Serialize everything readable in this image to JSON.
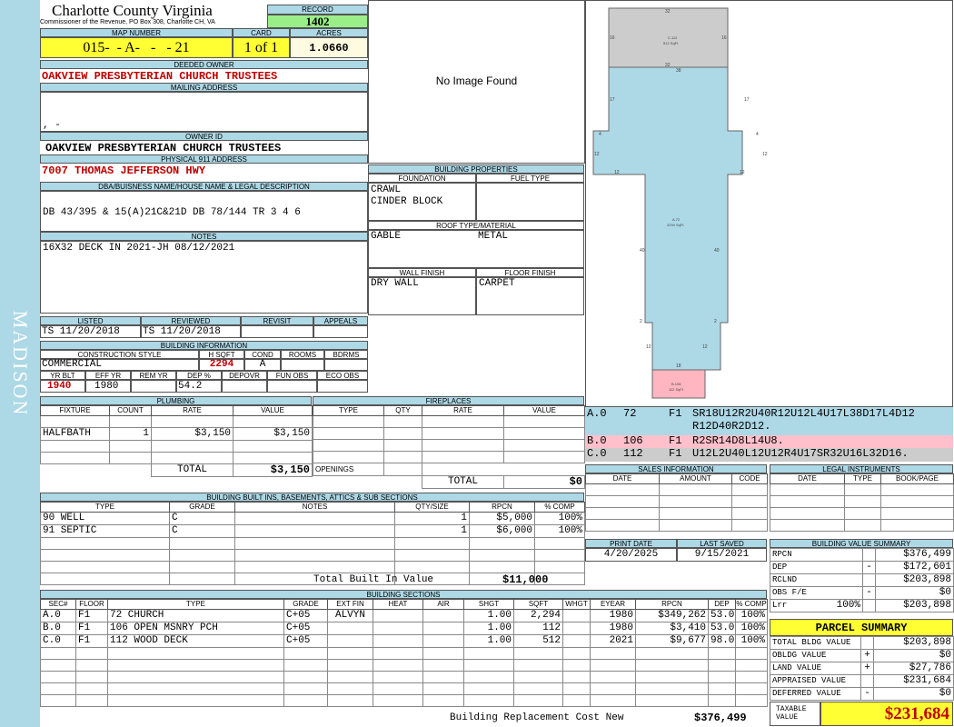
{
  "side_label": "MADISON",
  "county": {
    "name": "Charlotte County Virginia",
    "address": "Commissioner of the Revenue, PO Box 308, Charlotte CH, VA"
  },
  "record": {
    "label": "RECORD",
    "value": "1402"
  },
  "map": {
    "label": "MAP NUMBER",
    "value": "015-  - A-   -   - 21"
  },
  "card": {
    "label": "CARD",
    "value": "1 of 1"
  },
  "acres": {
    "label": "ACRES",
    "value": "1.0660"
  },
  "deeded_owner": {
    "label": "DEEDED OWNER",
    "value": "OAKVIEW PRESBYTERIAN CHURCH TRUSTEES"
  },
  "mailing_address": {
    "label": "MAILING ADDRESS",
    "value": ",  -"
  },
  "owner_id": {
    "label": "OWNER ID",
    "value": "OAKVIEW PRESBYTERIAN CHURCH TRUSTEES"
  },
  "physical_address": {
    "label": "PHYSICAL 911 ADDRESS",
    "value": "7007 THOMAS JEFFERSON HWY"
  },
  "legal": {
    "label": "DBA/BUISNESS NAME/HOUSE NAME & LEGAL DESCRIPTION",
    "value": "DB 43/395 & 15(A)21C&21D DB 78/144 TR  3 4 6"
  },
  "notes": {
    "label": "NOTES",
    "value": "16X32 DECK IN 2021-JH 08/12/2021"
  },
  "photo": {
    "text": "No Image Found"
  },
  "building_properties": {
    "title": "BUILDING PROPERTIES",
    "foundation_label": "FOUNDATION",
    "fuel_label": "FUEL TYPE",
    "foundation_1": "CRAWL",
    "foundation_2": "CINDER BLOCK",
    "roof_label": "ROOF TYPE/MATERIAL",
    "roof_type": "GABLE",
    "roof_material": "METAL",
    "wall_label": "WALL FINISH",
    "floor_label": "FLOOR FINISH",
    "wall": "DRY WALL",
    "floor": "CARPET"
  },
  "listed": {
    "listed_label": "LISTED",
    "reviewed_label": "REVIEWED",
    "revisit_label": "REVISIT",
    "appeals_label": "APPEALS",
    "listed": "TS  11/20/2018",
    "reviewed": "TS  11/20/2018"
  },
  "building_info": {
    "title": "BUILDING INFORMATION",
    "labels": {
      "style": "CONSTRUCTION STYLE",
      "hsqft": "H SQFT",
      "cond": "COND",
      "rooms": "ROOMS",
      "bdrms": "BDRMS",
      "yrblt": "YR BLT",
      "effyr": "EFF YR",
      "remyr": "REM YR",
      "dep": "DEP %",
      "depovr": "DEPOVR",
      "funobs": "FUN OBS",
      "ecoobs": "ECO OBS"
    },
    "style": "COMMERCIAL",
    "hsqft": "2294",
    "cond": "A",
    "yrblt": "1940",
    "effyr": "1980",
    "dep": "54.2"
  },
  "plumbing": {
    "title": "PLUMBING",
    "headers": [
      "FIXTURE",
      "COUNT",
      "RATE",
      "VALUE"
    ],
    "rows": [
      {
        "fixture": "HALFBATH",
        "count": "1",
        "rate": "$3,150",
        "value": "$3,150"
      }
    ],
    "total_label": "TOTAL",
    "total": "$3,150"
  },
  "fireplaces": {
    "title": "FIREPLACES",
    "headers": [
      "TYPE",
      "QTY",
      "RATE",
      "VALUE"
    ],
    "openings_label": "OPENINGS",
    "total_label": "TOTAL",
    "total": "$0"
  },
  "built_ins": {
    "title": "BUILDING BUILT INS, BASEMENTS, ATTICS & SUB SECTIONS",
    "headers": [
      "TYPE",
      "GRADE",
      "NOTES",
      "QTY/SIZE",
      "RPCN",
      "% COMP"
    ],
    "rows": [
      {
        "type": "90 WELL",
        "grade": "C",
        "notes": "",
        "qty": "1",
        "rpcn": "$5,000",
        "comp": "100%"
      },
      {
        "type": "91 SEPTIC",
        "grade": "C",
        "notes": "",
        "qty": "1",
        "rpcn": "$6,000",
        "comp": "100%"
      }
    ],
    "total_label": "Total Built In Value",
    "total": "$11,000"
  },
  "sketch": {
    "labels": [
      {
        "id": "C",
        "text": "C.112",
        "sub": "512 SqFt"
      },
      {
        "id": "A",
        "text": "A.72",
        "sub": "2294 SqFt"
      },
      {
        "id": "B",
        "text": "B.106",
        "sub": "112 SqFt"
      }
    ],
    "dims": [
      "32",
      "16",
      "16",
      "32",
      "38",
      "17",
      "17",
      "4",
      "4",
      "12",
      "12",
      "12",
      "12",
      "40",
      "40",
      "2",
      "2",
      "12",
      "12",
      "18"
    ]
  },
  "traverse": [
    {
      "sec": "A.0",
      "num": "72",
      "floor": "F1",
      "line1": "SR18U12R2U40R12U12L4U17L38D17L4D12",
      "line2": "R12D40R2D12."
    },
    {
      "sec": "B.0",
      "num": "106",
      "floor": "F1",
      "line1": "R2SR14D8L14U8.",
      "line2": ""
    },
    {
      "sec": "C.0",
      "num": "112",
      "floor": "F1",
      "line1": "U12L2U40L12U12R4U17SR32U16L32D16.",
      "line2": ""
    }
  ],
  "sales": {
    "title": "SALES INFORMATION",
    "headers": [
      "DATE",
      "AMOUNT",
      "CODE"
    ]
  },
  "legal_instruments": {
    "title": "LEGAL INSTRUMENTS",
    "headers": [
      "DATE",
      "TYPE",
      "BOOK/PAGE"
    ]
  },
  "print_date": {
    "label": "PRINT DATE",
    "value": "4/20/2025"
  },
  "last_saved": {
    "label": "LAST SAVED",
    "value": "9/15/2021"
  },
  "value_summary": {
    "title": "BUILDING VALUE SUMMARY",
    "rows": [
      {
        "label": "RPCN",
        "sign": "",
        "value": "$376,499"
      },
      {
        "label": "DEP",
        "sign": "-",
        "value": "$172,601"
      },
      {
        "label": "RCLND",
        "sign": "",
        "value": "$203,898"
      },
      {
        "label": "OBS F/E",
        "sign": "-",
        "value": "$0"
      },
      {
        "label": "Lrr",
        "pct": "100%",
        "sign": "",
        "value": "$203,898"
      }
    ]
  },
  "building_sections": {
    "title": "BUILDING SECTIONS",
    "headers": [
      "SEC#",
      "FLOOR",
      "TYPE",
      "GRADE",
      "EXT FIN",
      "HEAT",
      "AIR",
      "SHGT",
      "SQFT",
      "WHGT",
      "EYEAR",
      "RPCN",
      "DEP",
      "% COMP"
    ],
    "rows": [
      {
        "sec": "A.0",
        "floor": "F1",
        "type": "72 CHURCH",
        "grade": "C+05",
        "ext": "ALVYN",
        "heat": "",
        "air": "",
        "shgt": "1.00",
        "sqft": "2,294",
        "whgt": "",
        "eyear": "1980",
        "rpcn": "$349,262",
        "dep": "53.0",
        "comp": "100%"
      },
      {
        "sec": "B.0",
        "floor": "F1",
        "type": "106 OPEN MSNRY PCH",
        "grade": "C+05",
        "ext": "",
        "heat": "",
        "air": "",
        "shgt": "1.00",
        "sqft": "112",
        "whgt": "",
        "eyear": "1980",
        "rpcn": "$3,410",
        "dep": "53.0",
        "comp": "100%"
      },
      {
        "sec": "C.0",
        "floor": "F1",
        "type": "112 WOOD DECK",
        "grade": "C+05",
        "ext": "",
        "heat": "",
        "air": "",
        "shgt": "1.00",
        "sqft": "512",
        "whgt": "",
        "eyear": "2021",
        "rpcn": "$9,677",
        "dep": "98.0",
        "comp": "100%"
      }
    ],
    "total_label": "Building Replacement Cost New",
    "total": "$376,499"
  },
  "parcel_summary": {
    "title": "PARCEL SUMMARY",
    "rows": [
      {
        "label": "TOTAL BLDG VALUE",
        "sign": "",
        "value": "$203,898"
      },
      {
        "label": "OBLDG VALUE",
        "sign": "+",
        "value": "$0"
      },
      {
        "label": "LAND VALUE",
        "sign": "+",
        "value": "$27,786"
      },
      {
        "label": "APPRAISED VALUE",
        "sign": "",
        "value": "$231,684"
      },
      {
        "label": "DEFERRED VALUE",
        "sign": "-",
        "value": "$0"
      }
    ],
    "taxable_label": "TAXABLE VALUE",
    "taxable": "$231,684"
  },
  "colors": {
    "sidebar": "#add8e6",
    "header": "#add8e6",
    "yellow": "#ffff33",
    "green": "#99ee88",
    "red": "#c00000",
    "sketch_main": "#add8e6",
    "sketch_deck": "#cccccc",
    "sketch_porch": "#ffb6c1",
    "traverse_pink": "#ffc0cb"
  }
}
